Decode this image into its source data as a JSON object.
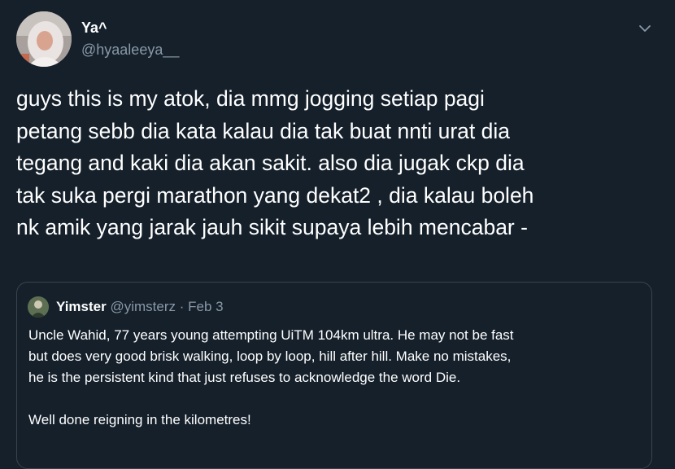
{
  "author": {
    "display_name": "Ya^",
    "handle": "@hyaaleeya__",
    "avatar_icon": "profile-photo"
  },
  "menu_icon": "chevron-down-icon",
  "tweet_lines": [
    "guys this is my atok, dia mmg jogging setiap pagi",
    "petang sebb dia kata kalau dia tak buat nnti urat dia",
    "tegang and kaki dia akan sakit. also dia jugak ckp dia",
    "tak suka pergi marathon yang dekat2 , dia kalau boleh",
    "nk amik yang jarak jauh sikit supaya lebih mencabar -"
  ],
  "quoted_tweet": {
    "display_name": "Yimster",
    "handle": "@yimsterz",
    "separator": "·",
    "date": "Feb 3",
    "lines": [
      "Uncle Wahid, 77 years young attempting UiTM 104km ultra. He may not be fast",
      "but does very good brisk walking, loop by loop, hill after hill. Make no mistakes,",
      "he is the persistent kind that just refuses to acknowledge the word Die."
    ],
    "closing": "Well done reigning in the kilometres!"
  },
  "colors": {
    "background": "#15202b",
    "text": "#ffffff",
    "secondary": "#8899a6",
    "border": "#38444d"
  }
}
